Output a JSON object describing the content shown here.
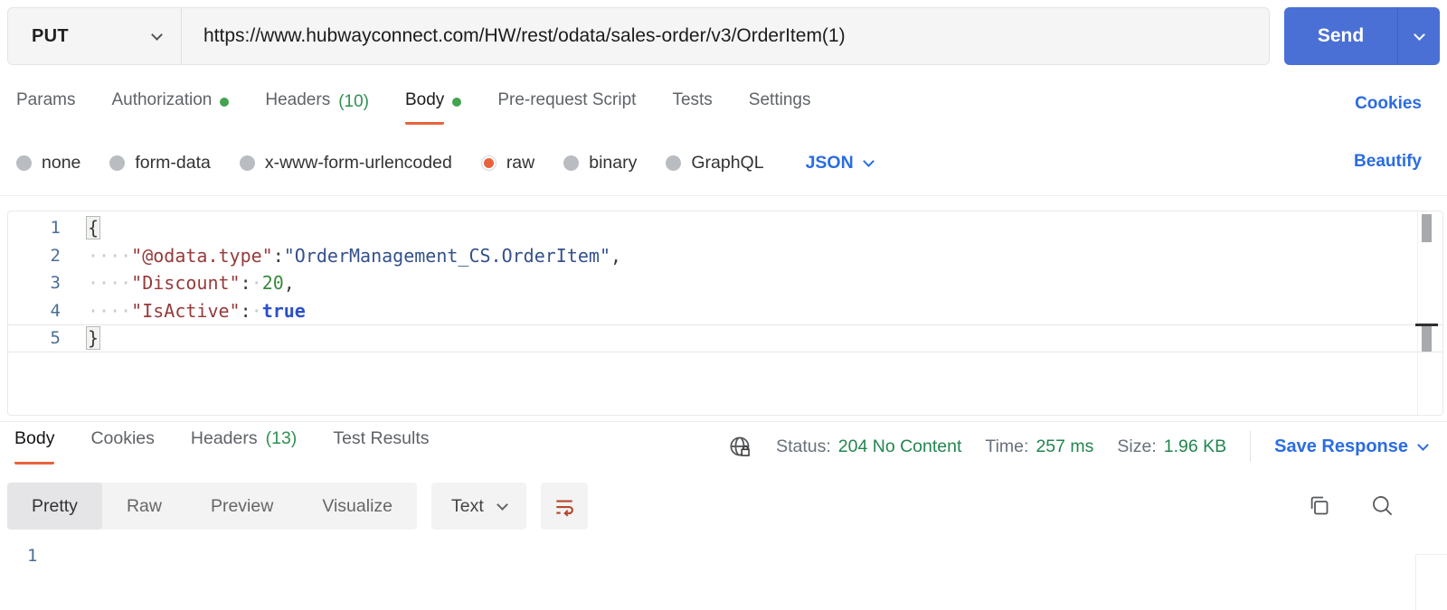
{
  "colors": {
    "accent_orange": "#e8633c",
    "link_blue": "#2b6ce0",
    "success_green": "#22854e",
    "send_blue": "#4b70d5"
  },
  "icons": {
    "method_chevron": "chevron-down",
    "send_chevron": "chevron-down",
    "json_chevron": "chevron-down",
    "globe_lock_icon": "globe-with-lock",
    "save_response_chevron": "chevron-down",
    "text_chevron": "chevron-down",
    "wrap_icon": "text-wrap",
    "copy_icon": "copy",
    "search_icon": "magnifier"
  },
  "request": {
    "method": "PUT",
    "url": "https://www.hubwayconnect.com/HW/rest/odata/sales-order/v3/OrderItem(1)",
    "send": "Send",
    "cookies": "Cookies",
    "tabs": {
      "params": "Params",
      "authorization": "Authorization",
      "headers": "Headers",
      "headers_count": "(10)",
      "body": "Body",
      "prerequest": "Pre-request Script",
      "tests": "Tests",
      "settings": "Settings"
    },
    "active_tab": "Body",
    "body_modes": {
      "none": "none",
      "form_data": "form-data",
      "urlencoded": "x-www-form-urlencoded",
      "raw": "raw",
      "binary": "binary",
      "graphql": "GraphQL"
    },
    "selected_mode": "raw",
    "language": "JSON",
    "beautify": "Beautify",
    "editor": {
      "lines": [
        {
          "num": "1",
          "open": "{"
        },
        {
          "num": "2",
          "ws": "····",
          "key": "\"@odata.type\"",
          "colon": ":",
          "value": "\"OrderManagement_CS.OrderItem\"",
          "comma": ","
        },
        {
          "num": "3",
          "ws": "····",
          "key": "\"Discount\"",
          "colon": ":",
          "sp": "·",
          "value": "20",
          "comma": ","
        },
        {
          "num": "4",
          "ws": "····",
          "key": "\"IsActive\"",
          "colon": ":",
          "sp": "·",
          "value": "true"
        },
        {
          "num": "5",
          "close": "}"
        }
      ]
    }
  },
  "response": {
    "tabs": {
      "body": "Body",
      "cookies": "Cookies",
      "headers": "Headers",
      "headers_count": "(13)",
      "test_results": "Test Results"
    },
    "active_tab": "Body",
    "status_label": "Status:",
    "status_value": "204 No Content",
    "time_label": "Time:",
    "time_value": "257 ms",
    "size_label": "Size:",
    "size_value": "1.96 KB",
    "save_response": "Save Response",
    "view_tabs": {
      "pretty": "Pretty",
      "raw": "Raw",
      "preview": "Preview",
      "visualize": "Visualize"
    },
    "active_view": "Pretty",
    "format": "Text",
    "body_line_number": "1"
  }
}
